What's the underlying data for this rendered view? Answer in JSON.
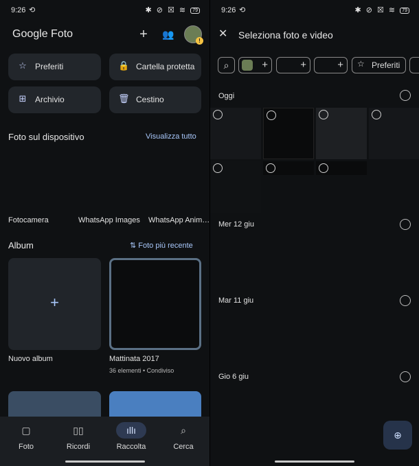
{
  "status": {
    "time": "9:26",
    "sync": "⟲",
    "icons": "✱ ⊘ ☒ ≋",
    "battery": "79"
  },
  "left": {
    "app_title_a": "Google",
    "app_title_b": "Foto",
    "add_icon": "+",
    "people_icon": "👥",
    "chips": [
      {
        "label": "Preferiti",
        "icon": "☆"
      },
      {
        "label": "Cartella protetta",
        "icon": "🔒"
      },
      {
        "label": "Archivio",
        "icon": "⊞"
      },
      {
        "label": "Cestino",
        "icon": "🗑"
      }
    ],
    "device_section": {
      "title": "Foto sul dispositivo",
      "link": "Visualizza tutto"
    },
    "device_folders": [
      "Fotocamera",
      "WhatsApp Images",
      "WhatsApp Anim…"
    ],
    "album_section": {
      "title": "Album",
      "sort_link": "Foto più recente",
      "sort_icon": "⇅"
    },
    "albums": [
      {
        "name": "Nuovo album",
        "plus": "+"
      },
      {
        "name": "Mattinata 2017",
        "meta": "36 elementi • Condiviso"
      }
    ],
    "nav": [
      {
        "label": "Foto",
        "icon": "▢"
      },
      {
        "label": "Ricordi",
        "icon": "▯▯"
      },
      {
        "label": "Raccolta",
        "icon": "ıllı"
      },
      {
        "label": "Cerca",
        "icon": "⌕"
      }
    ]
  },
  "right": {
    "title": "Seleziona foto e video",
    "close_icon": "✕",
    "filter_chips": [
      {
        "label": "Preferiti",
        "icon": "☆"
      }
    ],
    "search_icon": "⌕",
    "days": [
      "Oggi",
      "Mer 12 giu",
      "Mar 11 giu",
      "Gio 6 giu"
    ],
    "zoom_icon": "⊕"
  }
}
